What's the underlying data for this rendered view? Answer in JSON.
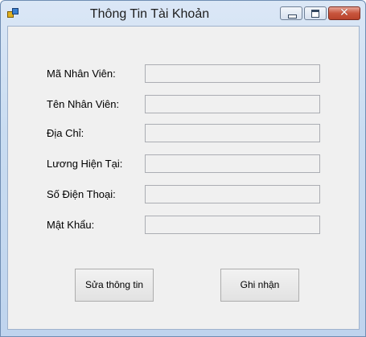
{
  "window": {
    "title": "Thông Tin Tài Khoản"
  },
  "controls": {
    "minimize_icon": "minimize-icon",
    "maximize_icon": "maximize-icon",
    "close_icon": "close-icon",
    "close_glyph": "✕"
  },
  "form": {
    "fields": [
      {
        "label": "Mã Nhân Viên:",
        "value": ""
      },
      {
        "label": "Tên Nhân Viên:",
        "value": ""
      },
      {
        "label": "Địa Chỉ:",
        "value": ""
      },
      {
        "label": "Lương Hiện Tại:",
        "value": ""
      },
      {
        "label": "Số Điện Thoại:",
        "value": ""
      },
      {
        "label": "Mật Khẩu:",
        "value": ""
      }
    ]
  },
  "buttons": {
    "edit_label": "Sửa thông tin",
    "save_label": "Ghi nhận"
  }
}
